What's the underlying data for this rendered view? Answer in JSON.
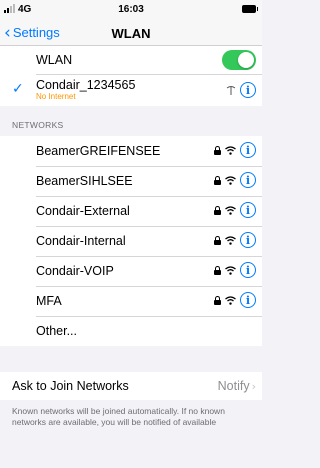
{
  "status_bar": {
    "carrier": "4G",
    "time": "16:03"
  },
  "nav": {
    "back_label": "Settings",
    "title": "WLAN"
  },
  "wlan": {
    "label": "WLAN",
    "enabled": true,
    "accent_color": "#34c759"
  },
  "connected_network": {
    "name": "Condair_1234565",
    "status": "No Internet",
    "status_color": "#ff9500"
  },
  "networks_section": {
    "header": "NETWORKS",
    "items": [
      {
        "name": "BeamerGREIFENSEE",
        "icons": [
          "lock-icon",
          "wifi-icon",
          "info-icon"
        ]
      },
      {
        "name": "BeamerSIHLSEE",
        "icons": [
          "lock-icon",
          "wifi-icon",
          "info-icon"
        ]
      },
      {
        "name": "Condair-External",
        "icons": [
          "lock-icon",
          "wifi-icon",
          "info-icon"
        ]
      },
      {
        "name": "Condair-Internal",
        "icons": [
          "lock-icon",
          "wifi-icon",
          "info-icon"
        ]
      },
      {
        "name": "Condair-VOIP",
        "icons": [
          "lock-icon",
          "wifi-icon",
          "info-icon"
        ]
      },
      {
        "name": "MFA",
        "icons": [
          "lock-icon",
          "wifi-icon",
          "info-icon"
        ]
      }
    ],
    "other_label": "Other..."
  },
  "ask_to_join": {
    "label": "Ask to Join Networks",
    "value": "Notify"
  },
  "footer_text": "Known networks will be joined automatically. If no known networks are available, you will be notified of available",
  "accent": "#007aff"
}
